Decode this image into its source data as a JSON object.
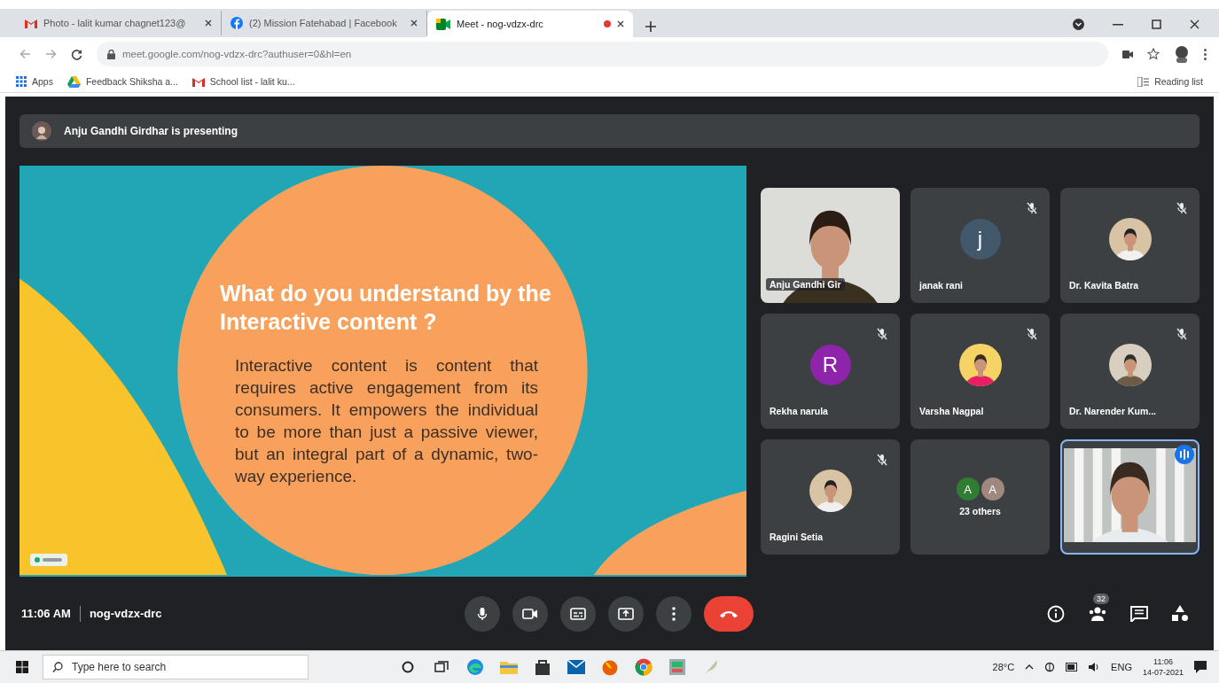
{
  "browser": {
    "tabs": [
      {
        "kind": "gmail",
        "title": "Photo - lalit kumar chagnet123@",
        "selected": false,
        "recording": false
      },
      {
        "kind": "facebook",
        "title": "(2) Mission Fatehabad | Facebook",
        "selected": false,
        "recording": false
      },
      {
        "kind": "meet",
        "title": "Meet - nog-vdzx-drc",
        "selected": true,
        "recording": true
      }
    ],
    "url": "meet.google.com/nog-vdzx-drc?authuser=0&hl=en",
    "bookmarks": [
      {
        "kind": "apps",
        "label": "Apps"
      },
      {
        "kind": "drive",
        "label": "Feedback Shiksha a..."
      },
      {
        "kind": "gmail",
        "label": "School list - lalit ku..."
      }
    ],
    "reading_list": "Reading list"
  },
  "meet": {
    "presenter_banner": "Anju Gandhi Girdhar is presenting",
    "slide": {
      "title": "What do you understand by the  Interactive content ?",
      "body": "Interactive content is content that requires active engagement from its consumers. It empowers the individual to be more than just a passive viewer, but an integral part of a dynamic, two-way experience."
    },
    "tiles": [
      {
        "kind": "video",
        "name": "Anju Gandhi Gir",
        "muted": false,
        "speaking": false
      },
      {
        "kind": "initial",
        "name": "janak rani",
        "initial": "j",
        "color": "#41596a",
        "muted": true,
        "speaking": false
      },
      {
        "name": "Dr. Kavita Batra",
        "muted": true,
        "speaking": false
      },
      {
        "kind": "initial",
        "name": "Rekha narula",
        "initial": "R",
        "color": "#8e24aa",
        "muted": true,
        "speaking": false
      },
      {
        "name": "Varsha Nagpal",
        "muted": true,
        "speaking": false
      },
      {
        "name": "Dr. Narender Kum...",
        "muted": true,
        "speaking": false
      },
      {
        "name": "Ragini Setia",
        "muted": true,
        "speaking": false
      },
      {
        "kind": "others",
        "name": "23 others",
        "avatars": [
          {
            "initial": "A",
            "color": "#2e7d32"
          },
          {
            "initial": "A",
            "color": "#a1887f"
          }
        ],
        "muted": false,
        "speaking": false
      },
      {
        "kind": "video",
        "muted": false,
        "speaking": true
      }
    ],
    "time": "11:06 AM",
    "meeting_code": "nog-vdzx-drc",
    "people_count": "32"
  },
  "taskbar": {
    "search_placeholder": "Type here to search",
    "temperature": "28°C",
    "language": "ENG",
    "time": "11:06",
    "date": "14-07-2021"
  }
}
